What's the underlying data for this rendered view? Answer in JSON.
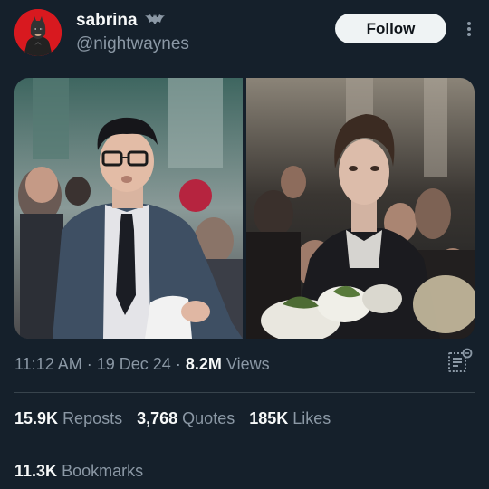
{
  "header": {
    "display_name": "sabrina",
    "handle": "@nightwaynes",
    "follow_label": "Follow"
  },
  "meta": {
    "time": "11:12 AM",
    "sep1": "·",
    "date": "19 Dec 24",
    "sep2": "·",
    "views_count": "8.2M",
    "views_label": "Views"
  },
  "stats": {
    "reposts_count": "15.9K",
    "reposts_label": "Reposts",
    "quotes_count": "3,768",
    "quotes_label": "Quotes",
    "likes_count": "185K",
    "likes_label": "Likes",
    "bookmarks_count": "11.3K",
    "bookmarks_label": "Bookmarks"
  },
  "icons": {
    "more": "more-vertical-icon",
    "analytics": "analytics-icon",
    "badge": "bat-emoji"
  },
  "colors": {
    "background": "#15202b",
    "text_primary": "#f7f9f9",
    "text_secondary": "#8b98a5",
    "follow_bg": "#eff3f4",
    "avatar_bg": "#d8191f"
  }
}
